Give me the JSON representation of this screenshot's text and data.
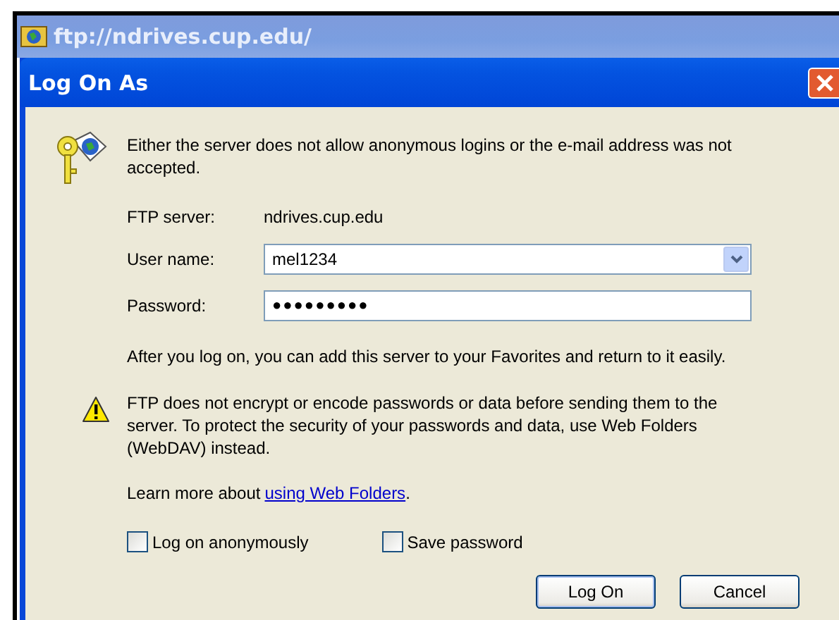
{
  "browser_window": {
    "title": "ftp://ndrives.cup.edu/"
  },
  "dialog": {
    "title": "Log On As",
    "message": "Either the server does not allow anonymous logins or the e-mail address was not accepted.",
    "server_label": "FTP server:",
    "server_value": "ndrives.cup.edu",
    "username_label": "User name:",
    "username_value": "mel1234",
    "password_label": "Password:",
    "password_value": "●●●●●●●●●",
    "info": "After you log on, you can add this server to your Favorites and return to it easily.",
    "warning": "FTP does not encrypt or encode passwords or data before sending them to the server.  To protect the security of your passwords and data, use Web Folders (WebDAV) instead.",
    "learn_more_text": "Learn more about",
    "learn_more_link": "using Web Folders",
    "learn_more_end": ".",
    "checkboxes": [
      {
        "label": "Log on anonymously",
        "checked": false
      },
      {
        "label": "Save password",
        "checked": false
      }
    ],
    "buttons": [
      "Log On",
      "Cancel"
    ]
  }
}
